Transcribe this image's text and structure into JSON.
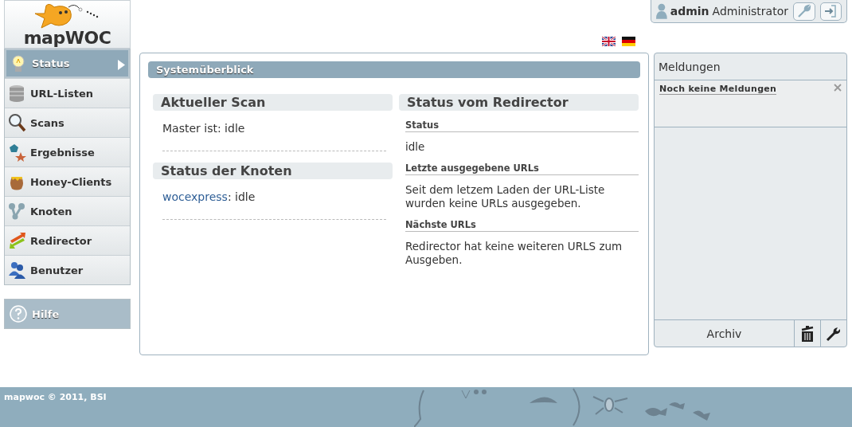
{
  "logo": {
    "text": "mapWOC"
  },
  "nav": [
    {
      "label": "Status",
      "selected": true
    },
    {
      "label": "URL-Listen",
      "selected": false
    },
    {
      "label": "Scans",
      "selected": false
    },
    {
      "label": "Ergebnisse",
      "selected": false
    },
    {
      "label": "Honey-Clients",
      "selected": false
    },
    {
      "label": "Knoten",
      "selected": false
    },
    {
      "label": "Redirector",
      "selected": false
    },
    {
      "label": "Benutzer",
      "selected": false
    }
  ],
  "help": {
    "label": "Hilfe"
  },
  "user": {
    "name": "admin",
    "role": "Administrator"
  },
  "main": {
    "title": "Systemüberblick",
    "current_scan": {
      "heading": "Aktueller Scan",
      "text": "Master ist: idle"
    },
    "nodes": {
      "heading": "Status der Knoten",
      "items": [
        {
          "name": "wocexpress",
          "status": ": idle"
        }
      ]
    },
    "redirector": {
      "heading": "Status vom Redirector",
      "sections": [
        {
          "label": "Status",
          "text": "idle"
        },
        {
          "label": "Letzte ausgegebene URLs",
          "text": "Seit dem letzem Laden der URL-Liste wurden keine URLs ausgegeben."
        },
        {
          "label": "Nächste URLs",
          "text": "Redirector hat keine weiteren URLS zum Ausgeben."
        }
      ]
    }
  },
  "messages": {
    "title": "Meldungen",
    "items": [
      {
        "text": "Noch keine Meldungen"
      }
    ],
    "archive": "Archiv"
  },
  "footer": {
    "text": "mapwoc © 2011, BSI"
  }
}
